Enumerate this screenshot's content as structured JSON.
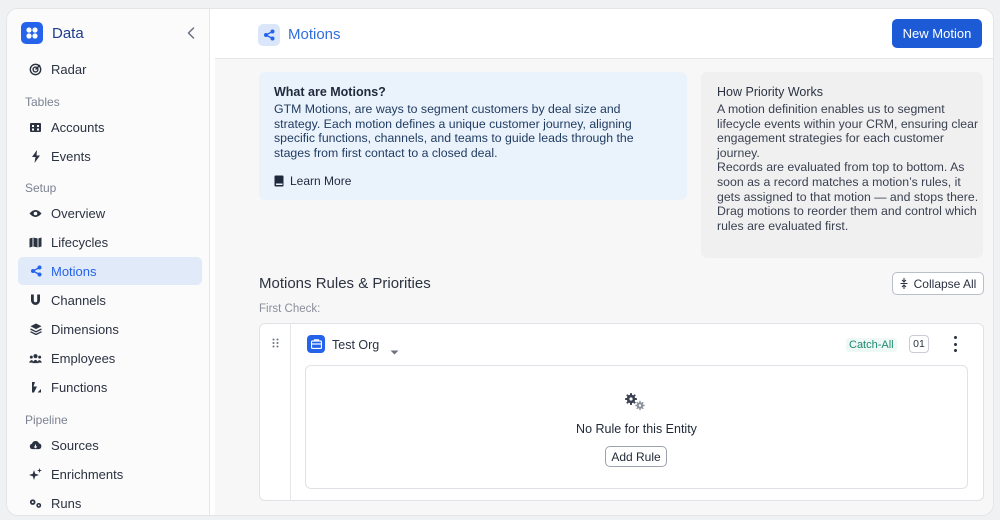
{
  "app": {
    "name": "Data",
    "brand_color": "#2563eb"
  },
  "sidebar": {
    "top_items": [
      {
        "label": "Radar",
        "icon": "radar-icon"
      }
    ],
    "sections": [
      {
        "label": "Tables",
        "items": [
          {
            "label": "Accounts",
            "icon": "building-icon"
          },
          {
            "label": "Events",
            "icon": "bolt-icon"
          }
        ]
      },
      {
        "label": "Setup",
        "items": [
          {
            "label": "Overview",
            "icon": "eye-icon"
          },
          {
            "label": "Lifecycles",
            "icon": "map-icon"
          },
          {
            "label": "Motions",
            "icon": "share-nodes-icon",
            "active": true
          },
          {
            "label": "Channels",
            "icon": "magnet-icon"
          },
          {
            "label": "Dimensions",
            "icon": "layers-icon"
          },
          {
            "label": "Employees",
            "icon": "users-icon"
          },
          {
            "label": "Functions",
            "icon": "function-icon"
          }
        ]
      },
      {
        "label": "Pipeline",
        "items": [
          {
            "label": "Sources",
            "icon": "cloud-icon"
          },
          {
            "label": "Enrichments",
            "icon": "sparkle-icon"
          },
          {
            "label": "Runs",
            "icon": "cogs-icon"
          }
        ]
      }
    ]
  },
  "header": {
    "title": "Motions",
    "new_button": "New Motion"
  },
  "info": {
    "title": "What are Motions?",
    "body": "GTM Motions, are ways to segment customers by deal size and strategy. Each motion defines a unique customer journey, aligning specific functions, channels, and teams to guide leads through the stages from first contact to a closed deal.",
    "learn_more": "Learn More"
  },
  "priority": {
    "title": "How Priority Works",
    "body": "A motion definition enables us to segment lifecycle events within your CRM, ensuring clear engagement strategies for each customer journey.\nRecords are evaluated from top to bottom. As soon as a record matches a motion’s rules, it gets assigned to that motion — and stops there.\nDrag motions to reorder them and control which rules are evaluated first."
  },
  "rules": {
    "heading": "Motions Rules & Priorities",
    "collapse_all": "Collapse All",
    "first_check": "First Check:",
    "entity": {
      "name": "Test Org",
      "tag": "Catch-All",
      "order": "01"
    },
    "empty_text": "No Rule for this Entity",
    "add_rule": "Add Rule"
  }
}
